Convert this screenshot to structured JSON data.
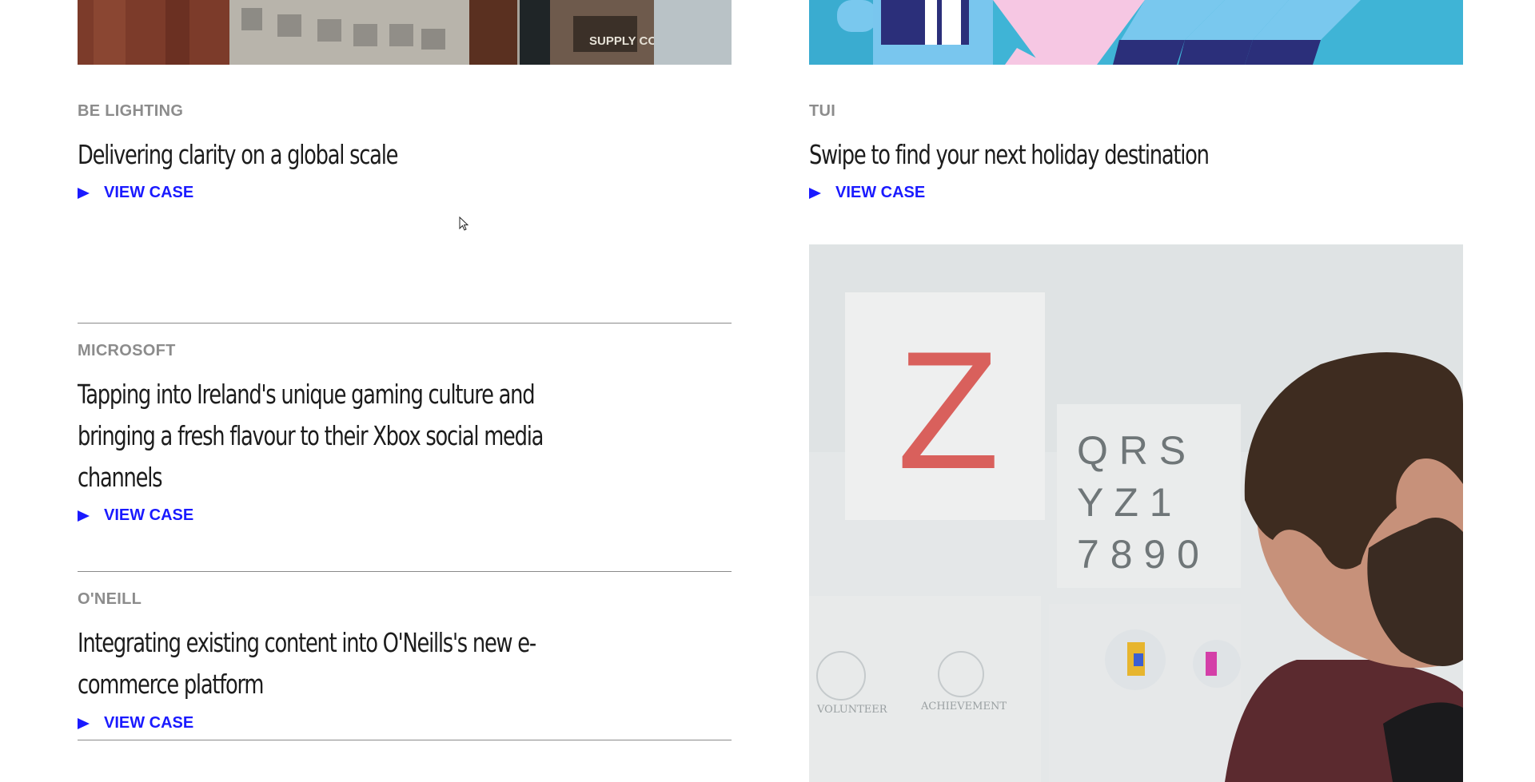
{
  "cases": {
    "be_lighting": {
      "client": "BE LIGHTING",
      "title": "Delivering clarity on a global scale",
      "cta": "VIEW CASE"
    },
    "tui": {
      "client": "TUI",
      "title": "Swipe to find your next holiday destination",
      "cta": "VIEW CASE"
    },
    "microsoft": {
      "client": "MICROSOFT",
      "title_lines": [
        "Tapping into Ireland's unique gaming culture and",
        "bringing a fresh flavour to their Xbox social media",
        "channels"
      ],
      "cta": "VIEW CASE"
    },
    "oneill": {
      "client": "O'NEILL",
      "title_lines": [
        "Integrating existing content into O'Neills's new e-",
        "commerce platform"
      ],
      "cta": "VIEW CASE"
    }
  },
  "photo_text": {
    "sign": "SUPPLY CO.",
    "big_letter": "Z",
    "letters_row1": "Q R S",
    "letters_row2": "Y Z 1",
    "letters_row3": "7 8 9 0",
    "stamp1": "VOLUNTEER",
    "stamp2": "ACHIEVEMENT"
  },
  "colors": {
    "accent": "#1a1aff",
    "label": "#8c8c8c",
    "title": "#1c1c1c",
    "divider": "#8a8a8a"
  },
  "icons": {
    "cta_arrow": "play-triangle-icon",
    "cursor": "mouse-pointer-icon"
  }
}
